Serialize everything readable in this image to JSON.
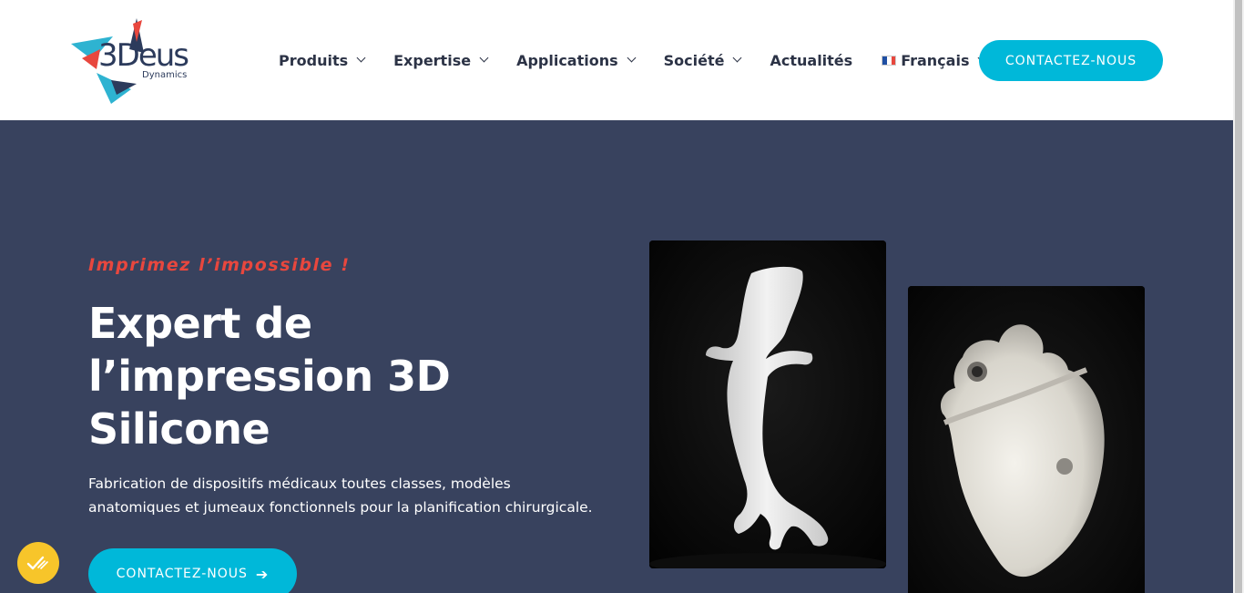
{
  "header": {
    "logo": {
      "wordmark": "3Deus",
      "subtitle": "Dynamics"
    },
    "nav": [
      {
        "label": "Produits",
        "has_dropdown": true
      },
      {
        "label": "Expertise",
        "has_dropdown": true
      },
      {
        "label": "Applications",
        "has_dropdown": true
      },
      {
        "label": "Société",
        "has_dropdown": true
      },
      {
        "label": "Actualités",
        "has_dropdown": false
      },
      {
        "label": "Français",
        "has_dropdown": true,
        "icon": "french-flag-icon"
      }
    ],
    "cta_label": "CONTACTEZ-NOUS"
  },
  "hero": {
    "tagline": "Imprimez l’impossible !",
    "headline": "Expert de l’impression 3D Silicone",
    "description": "Fabrication de dispositifs médicaux toutes classes, modèles anatomiques et jumeaux fonctionnels pour la planification chirurgicale.",
    "cta_label": "CONTACTEZ-NOUS",
    "cta_icon": "arrow-right-icon",
    "images": [
      {
        "name": "aorta-model-photo"
      },
      {
        "name": "heart-model-photo"
      }
    ]
  },
  "colors": {
    "accent": "#00b8d9",
    "tagline": "#e8473e",
    "hero_background": "#38425e",
    "nav_text": "#2c3346",
    "cookie_badge": "#f7c52a"
  },
  "cookie_badge": {
    "icon": "cookie-consent-icon"
  }
}
